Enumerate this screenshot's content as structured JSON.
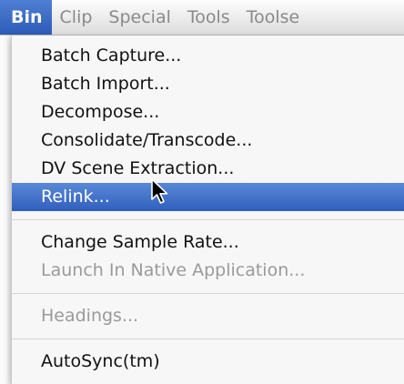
{
  "menubar": {
    "items": [
      {
        "label": "Bin",
        "active": true
      },
      {
        "label": "Clip",
        "active": false
      },
      {
        "label": "Special",
        "active": false
      },
      {
        "label": "Tools",
        "active": false
      },
      {
        "label": "Toolse",
        "active": false
      }
    ]
  },
  "bin_menu": {
    "items": [
      {
        "label": "Batch Capture...",
        "enabled": true
      },
      {
        "label": "Batch Import...",
        "enabled": true
      },
      {
        "label": "Decompose...",
        "enabled": true
      },
      {
        "label": "Consolidate/Transcode...",
        "enabled": true
      },
      {
        "label": "DV Scene Extraction...",
        "enabled": true
      },
      {
        "label": "Relink...",
        "enabled": true,
        "highlighted": true
      },
      {
        "label": "Change Sample Rate...",
        "enabled": true
      },
      {
        "label": "Launch In Native Application...",
        "enabled": false
      },
      {
        "label": "Headings...",
        "enabled": false
      },
      {
        "label": "AutoSync(tm)",
        "enabled": true
      }
    ]
  },
  "colors": {
    "highlight": "#3a68c4",
    "disabled_text": "#9a9a9a",
    "menubar_inactive_text": "#8a8a8a"
  },
  "cursor": {
    "icon": "arrow-pointer-icon"
  }
}
